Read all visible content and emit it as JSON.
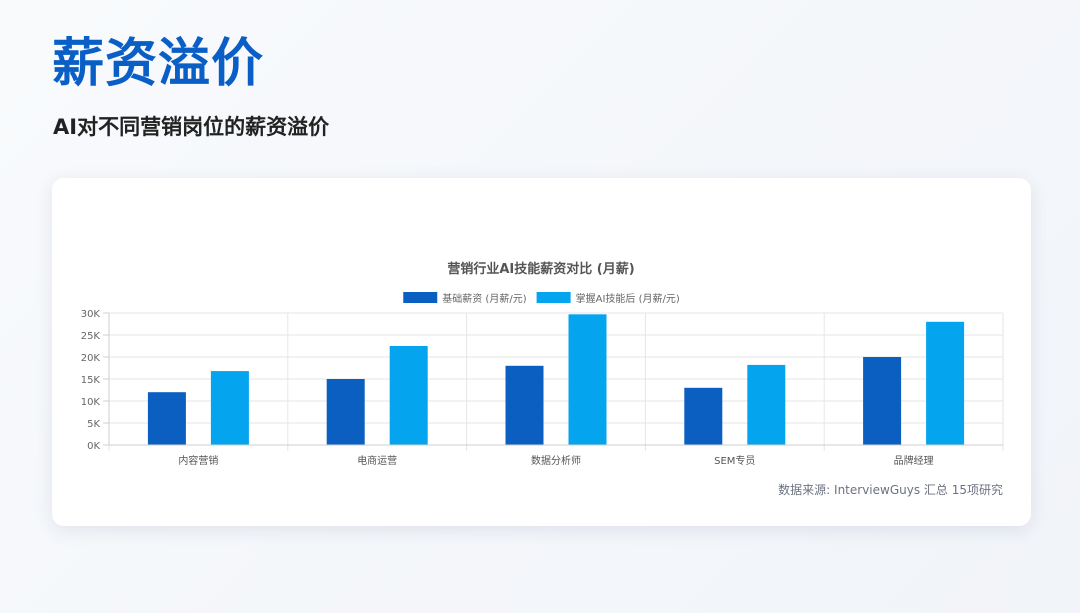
{
  "page": {
    "title": "薪资溢价",
    "subtitle": "AI对不同营销岗位的薪资溢价",
    "source": "数据来源: InterviewGuys 汇总 15项研究"
  },
  "chart_data": {
    "type": "bar",
    "title": "营销行业AI技能薪资对比 (月薪)",
    "categories": [
      "内容营销",
      "电商运营",
      "数据分析师",
      "SEM专员",
      "品牌经理"
    ],
    "series": [
      {
        "name": "基础薪资 (月薪/元)",
        "color": "#0a5fc0",
        "values": [
          12000,
          15000,
          18000,
          13000,
          20000
        ]
      },
      {
        "name": "掌握AI技能后 (月薪/元)",
        "color": "#05a4ee",
        "values": [
          16800,
          22500,
          29700,
          18200,
          28000
        ]
      }
    ],
    "ylim": [
      0,
      30000
    ],
    "yticks": [
      0,
      5000,
      10000,
      15000,
      20000,
      25000,
      30000
    ],
    "ytick_labels": [
      "0K",
      "5K",
      "10K",
      "15K",
      "20K",
      "25K",
      "30K"
    ],
    "grid": true,
    "legend": "top-center"
  }
}
